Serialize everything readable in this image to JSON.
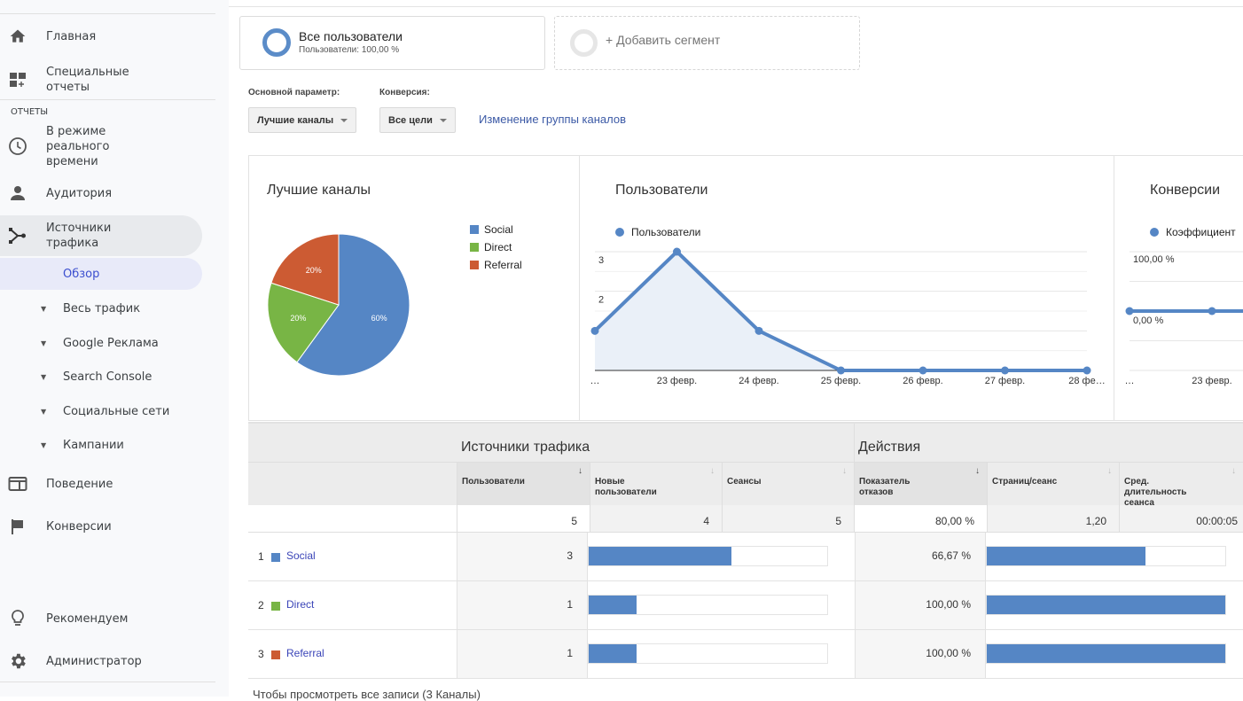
{
  "sidebar": {
    "items": [
      {
        "label": "Главная",
        "icon": "home-icon"
      },
      {
        "label": "Специальные\nотчеты",
        "icon": "custom-reports-icon"
      },
      {
        "label": "В режиме\nреального\nвремени",
        "icon": "clock-icon"
      },
      {
        "label": "Аудитория",
        "icon": "person-icon"
      },
      {
        "label": "Источники\nтрафика",
        "icon": "acquisition-icon"
      },
      {
        "label": "Обзор"
      },
      {
        "label": "Весь трафик"
      },
      {
        "label": "Google Реклама"
      },
      {
        "label": "Search Console"
      },
      {
        "label": "Социальные сети"
      },
      {
        "label": "Кампании"
      },
      {
        "label": "Поведение",
        "icon": "behavior-icon"
      },
      {
        "label": "Конверсии",
        "icon": "flag-icon"
      },
      {
        "label": "Рекомендуем",
        "icon": "lightbulb-icon"
      },
      {
        "label": "Администратор",
        "icon": "gear-icon"
      }
    ],
    "section_label": "ОТЧЕТЫ"
  },
  "segments": {
    "primary": {
      "title": "Все пользователи",
      "subtitle": "Пользователи: 100,00 %"
    },
    "add_label": "+ Добавить сегмент"
  },
  "filters": {
    "primary_dim_label": "Основной параметр:",
    "primary_dim_value": "Лучшие каналы",
    "conversion_label": "Конверсия:",
    "conversion_value": "Все цели",
    "change_group_link": "Изменение группы каналов"
  },
  "colors": {
    "social": "#5586c5",
    "direct": "#78b545",
    "referral": "#cc5b33",
    "accent": "#5586c5"
  },
  "chart_data": [
    {
      "type": "pie",
      "title": "Лучшие каналы",
      "categories": [
        "Social",
        "Direct",
        "Referral"
      ],
      "values": [
        60,
        20,
        20
      ],
      "labels": [
        "60%",
        "20%",
        "20%"
      ],
      "legend": "right"
    },
    {
      "type": "area",
      "title": "Пользователи",
      "legend": [
        "Пользователи"
      ],
      "x": [
        "…",
        "23 февр.",
        "24 февр.",
        "25 февр.",
        "26 февр.",
        "27 февр.",
        "28 фе…"
      ],
      "values": [
        1,
        3,
        1,
        0,
        0,
        0,
        0
      ],
      "yticks": [
        "1",
        "2",
        "3"
      ],
      "ylim": [
        0,
        3
      ]
    },
    {
      "type": "line",
      "title": "Конверсии",
      "legend": [
        "Коэффициент"
      ],
      "x": [
        "…",
        "23 февр."
      ],
      "values": [
        0,
        0
      ],
      "yticks": [
        "0,00 %",
        "100,00 %"
      ],
      "ylim": [
        -100,
        100
      ]
    }
  ],
  "table": {
    "groups": [
      "Источники трафика",
      "Действия"
    ],
    "columns": [
      {
        "label": "Пользователи",
        "total": "5"
      },
      {
        "label": "Новые\nпользователи",
        "total": "4"
      },
      {
        "label": "Сеансы",
        "total": "5"
      },
      {
        "label": "Показатель\nотказов",
        "total": "80,00 %"
      },
      {
        "label": "Страниц/сеанс",
        "total": "1,20"
      },
      {
        "label": "Сред.\nдлительность\nсеанса",
        "total": "00:00:05"
      }
    ],
    "rows": [
      {
        "rank": "1",
        "name": "Social",
        "users": "3",
        "users_share": 0.6,
        "bounce": "66,67 %",
        "bounce_share": 0.6667
      },
      {
        "rank": "2",
        "name": "Direct",
        "users": "1",
        "users_share": 0.2,
        "bounce": "100,00 %",
        "bounce_share": 1.0
      },
      {
        "rank": "3",
        "name": "Referral",
        "users": "1",
        "users_share": 0.2,
        "bounce": "100,00 %",
        "bounce_share": 1.0
      }
    ],
    "footnote": "Чтобы просмотреть все записи (3 Каналы)"
  }
}
